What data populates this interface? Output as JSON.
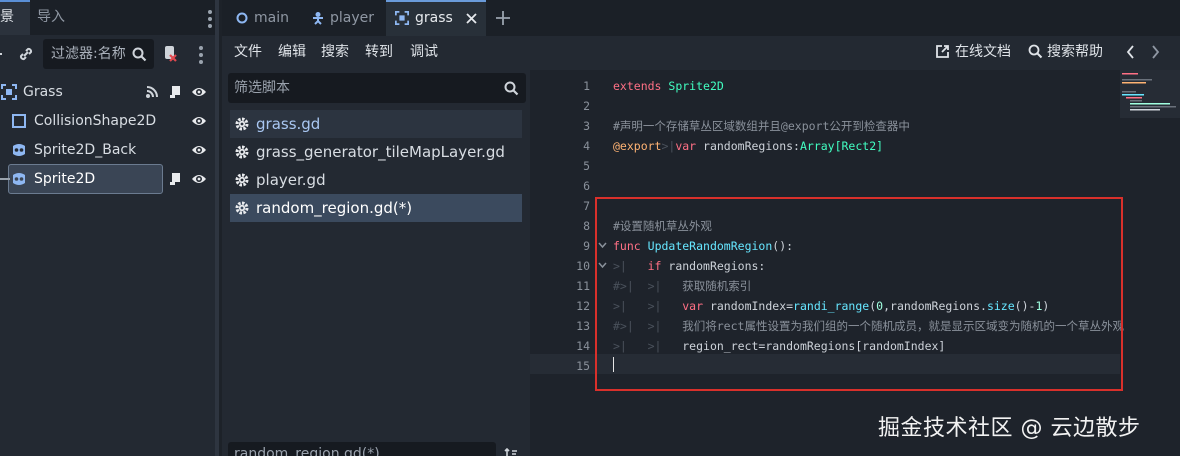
{
  "scene_dock": {
    "tab_scene": "景",
    "tab_import": "导入",
    "filter_placeholder": "过滤器:名称",
    "tree": [
      {
        "label": "Grass"
      },
      {
        "label": "CollisionShape2D"
      },
      {
        "label": "Sprite2D_Back"
      },
      {
        "label": "Sprite2D"
      }
    ]
  },
  "main_tabs": [
    {
      "label": "main"
    },
    {
      "label": "player"
    },
    {
      "label": "grass"
    }
  ],
  "menu": {
    "file": "文件",
    "edit": "编辑",
    "search": "搜索",
    "goto": "转到",
    "debug": "调试",
    "online_docs": "在线文档",
    "search_help": "搜索帮助"
  },
  "script_panel": {
    "filter_placeholder": "筛选脚本",
    "scripts": [
      {
        "label": "grass.gd"
      },
      {
        "label": "grass_generator_tileMapLayer.gd"
      },
      {
        "label": "player.gd"
      },
      {
        "label": "random_region.gd(*)"
      }
    ],
    "method_filter_text": "random_region.gd(*)"
  },
  "editor": {
    "line_numbers": [
      "1",
      "2",
      "3",
      "4",
      "5",
      "6",
      "7",
      "8",
      "9",
      "10",
      "11",
      "12",
      "13",
      "14",
      "15"
    ],
    "lines": {
      "l1_kw": "extends",
      "l1_ty": "Sprite2D",
      "l3": "#声明一个存储草丛区域数组并且@export公开到检查器中",
      "l4_an": "@export",
      "l4_kw": "var",
      "l4_id": " randomRegions:",
      "l4_ty": "Array[Rect2]",
      "l8": "#设置随机草丛外观",
      "l9_kw": "func",
      "l9_fn": "UpdateRandomRegion",
      "l9_rest": "():",
      "l10_kw": "if",
      "l10_rest": " randomRegions:",
      "l11": "获取随机索引",
      "l12_kw": "var",
      "l12_a": " randomIndex=",
      "l12_fn": "randi_range",
      "l12_b": "(",
      "l12_n0": "0",
      "l12_c": ",randomRegions.",
      "l12_fn2": "size",
      "l12_d": "()-",
      "l12_n1": "1",
      "l12_e": ")",
      "l13": "我们将rect属性设置为我们组的一个随机成员，就是显示区域变为随机的一个草丛外观",
      "l14": "region_rect=randomRegions[randomIndex]"
    }
  },
  "watermark": "掘金技术社区 @ 云边散步"
}
